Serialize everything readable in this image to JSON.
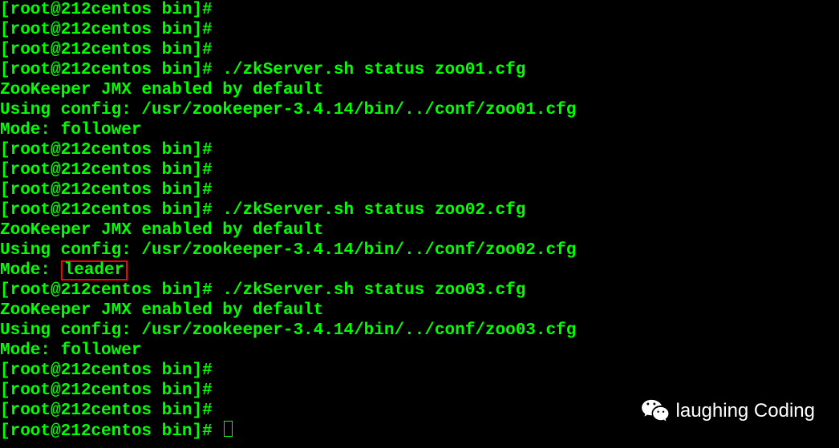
{
  "prompt": "[root@212centos bin]#",
  "lines": {
    "l0": "[root@212centos bin]#",
    "l1": "[root@212centos bin]#",
    "l2": "[root@212centos bin]#",
    "l3": "[root@212centos bin]# ./zkServer.sh status zoo01.cfg",
    "l4": "ZooKeeper JMX enabled by default",
    "l5": "Using config: /usr/zookeeper-3.4.14/bin/../conf/zoo01.cfg",
    "l6": "Mode: follower",
    "l7": "[root@212centos bin]#",
    "l8": "[root@212centos bin]#",
    "l9": "[root@212centos bin]#",
    "l10": "[root@212centos bin]# ./zkServer.sh status zoo02.cfg",
    "l11": "ZooKeeper JMX enabled by default",
    "l12": "Using config: /usr/zookeeper-3.4.14/bin/../conf/zoo02.cfg",
    "l13_pre": "Mode: ",
    "l13_hl": "leader",
    "l14": "[root@212centos bin]# ./zkServer.sh status zoo03.cfg",
    "l15": "ZooKeeper JMX enabled by default",
    "l16": "Using config: /usr/zookeeper-3.4.14/bin/../conf/zoo03.cfg",
    "l17": "Mode: follower",
    "l18": "[root@212centos bin]#",
    "l19": "[root@212centos bin]#",
    "l20": "[root@212centos bin]#",
    "l21": "[root@212centos bin]# "
  },
  "watermark": {
    "text": "laughing Coding"
  }
}
